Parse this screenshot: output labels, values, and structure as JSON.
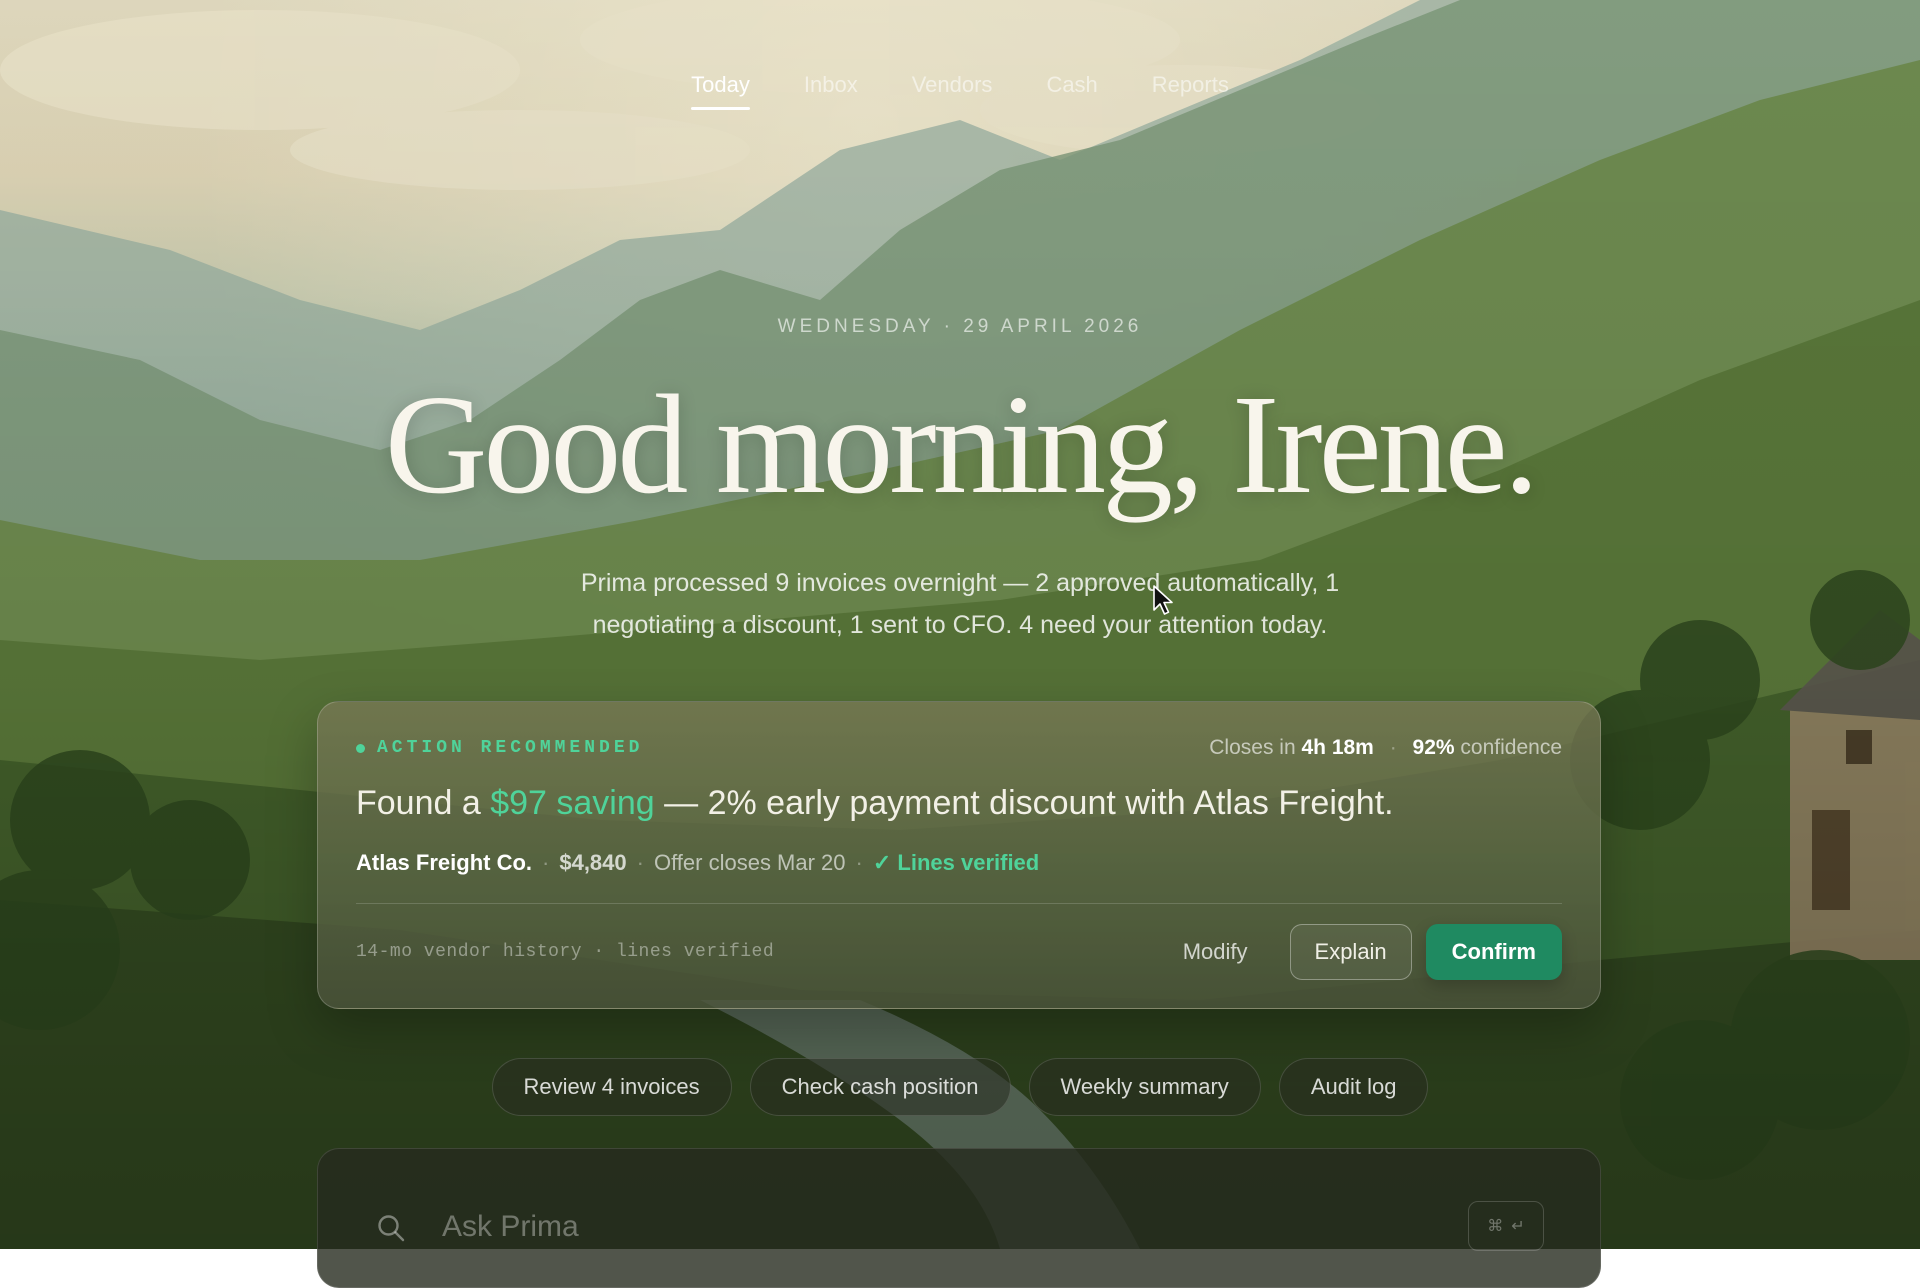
{
  "nav": {
    "items": [
      {
        "label": "Today",
        "active": true
      },
      {
        "label": "Inbox",
        "active": false
      },
      {
        "label": "Vendors",
        "active": false
      },
      {
        "label": "Cash",
        "active": false
      },
      {
        "label": "Reports",
        "active": false
      }
    ]
  },
  "hero": {
    "date": "WEDNESDAY · 29 APRIL 2026",
    "greeting": "Good morning, Irene.",
    "summary": "Prima processed 9 invoices overnight — 2 approved automatically, 1 negotiating a discount, 1 sent to CFO. 4 need your attention today."
  },
  "card": {
    "badge": "ACTION RECOMMENDED",
    "closes_prefix": "Closes in",
    "closes_time": "4h 18m",
    "confidence_value": "92%",
    "confidence_label": "confidence",
    "title_prefix": "Found a",
    "title_highlight": "$97 saving",
    "title_suffix": "— 2% early payment discount with Atlas Freight.",
    "vendor": "Atlas Freight Co.",
    "amount": "$4,840",
    "offer": "Offer closes Mar 20",
    "verified": "✓ Lines verified",
    "history": "14-mo vendor history · lines verified",
    "buttons": {
      "modify": "Modify",
      "explain": "Explain",
      "confirm": "Confirm"
    }
  },
  "chips": [
    "Review 4 invoices",
    "Check cash position",
    "Weekly summary",
    "Audit log"
  ],
  "ask": {
    "placeholder": "Ask Prima",
    "shortcut_mod": "⌘",
    "shortcut_key": "↵"
  },
  "colors": {
    "accent_green": "#4fd39a",
    "confirm_button": "#1f8a61"
  },
  "icons": {
    "search": "search-icon",
    "cursor": "mouse-pointer-icon"
  }
}
